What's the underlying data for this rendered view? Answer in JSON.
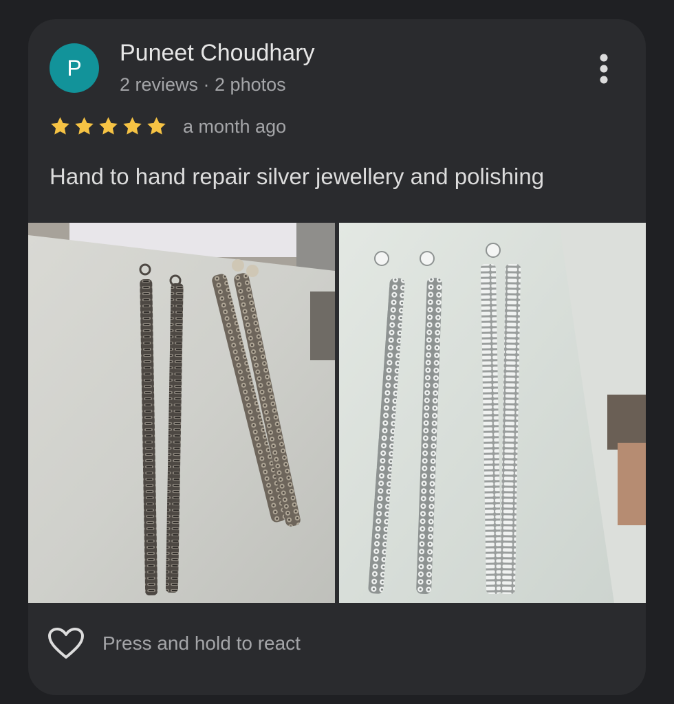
{
  "review": {
    "avatar_letter": "P",
    "avatar_color": "#12939a",
    "author_name": "Puneet Choudhary",
    "author_meta": "2 reviews · 2 photos",
    "rating": 5,
    "rating_max": 5,
    "time_ago": "a month ago",
    "text": "Hand to hand repair silver jewellery and polishing",
    "photos": [
      {
        "icon": "photo-tarnished-anklets"
      },
      {
        "icon": "photo-polished-anklets"
      }
    ],
    "react_label": "Press and hold to react",
    "more_icon": "more-vert-icon",
    "react_icon": "heart-outline-icon",
    "star_color": "#f6c344"
  }
}
